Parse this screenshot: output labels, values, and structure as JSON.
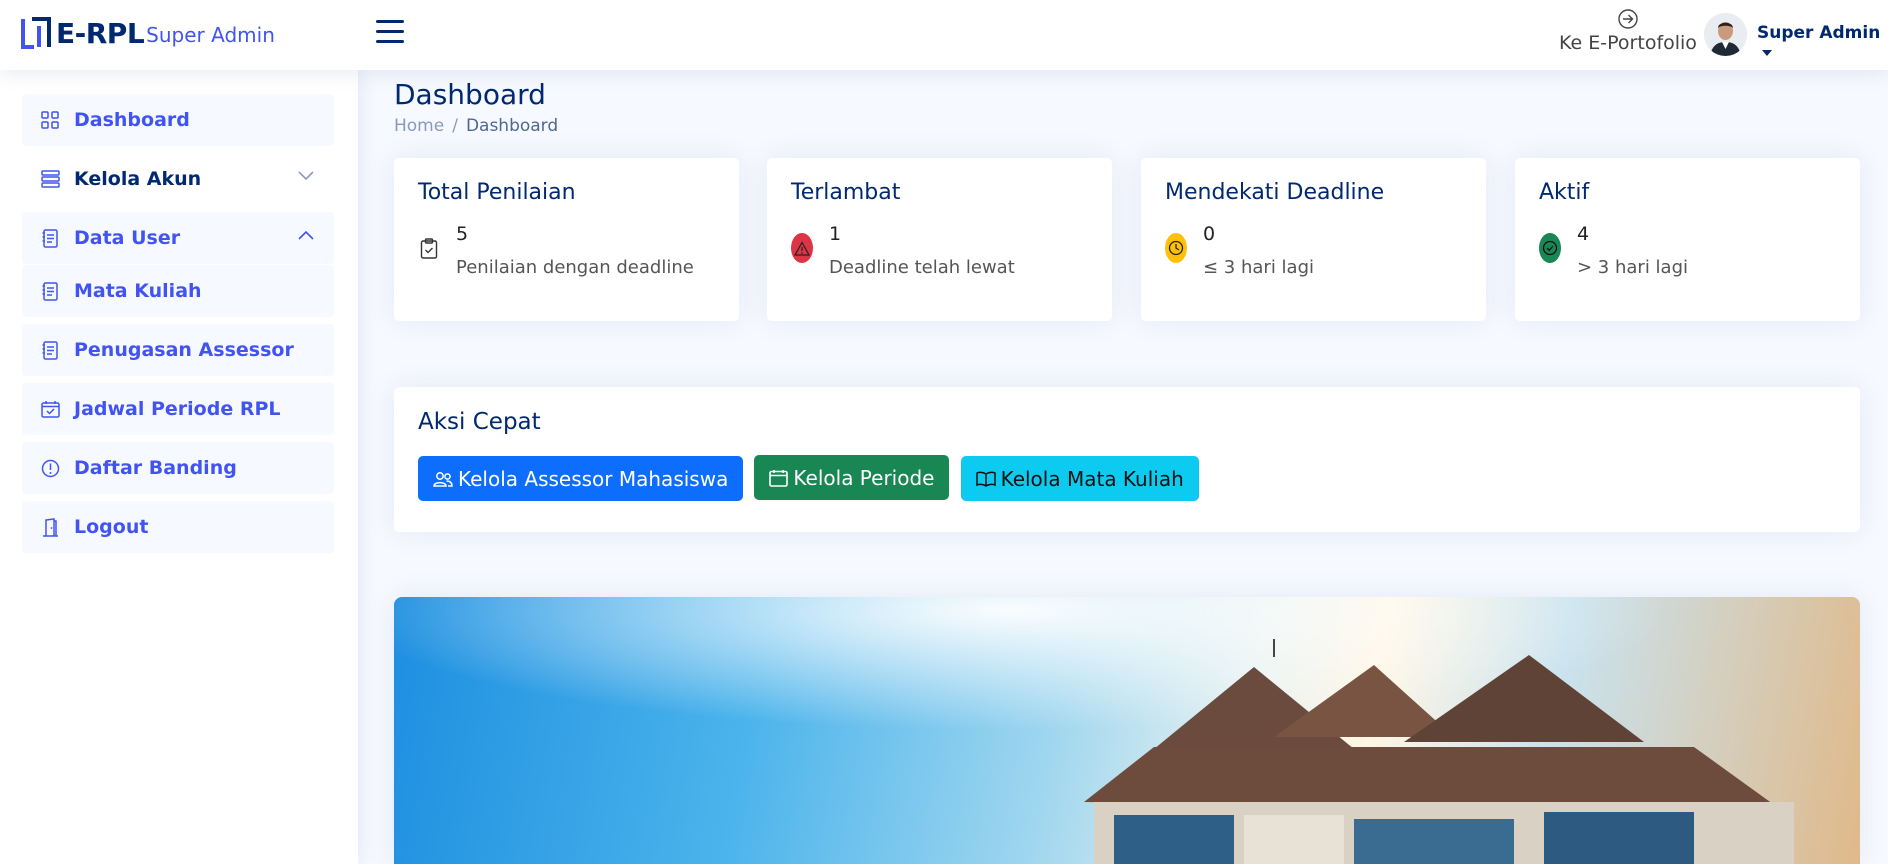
{
  "header": {
    "logo_text": "E-RPL",
    "logo_sub": "Super Admin",
    "portfolio_label": "Ke E-Portofolio",
    "user_name": "Super Admin"
  },
  "sidebar": {
    "items": [
      {
        "label": "Dashboard",
        "icon": "grid-icon"
      },
      {
        "label": "Kelola Akun",
        "icon": "server-icon",
        "chevron": "down"
      },
      {
        "label": "Data User",
        "icon": "document-icon",
        "chevron": "up"
      },
      {
        "label": "Mata Kuliah",
        "icon": "document-icon"
      },
      {
        "label": "Penugasan Assessor",
        "icon": "document-icon"
      },
      {
        "label": "Jadwal Periode RPL",
        "icon": "calendar-check-icon"
      },
      {
        "label": "Daftar Banding",
        "icon": "exclamation-circle-icon"
      },
      {
        "label": "Logout",
        "icon": "door-icon"
      }
    ]
  },
  "page": {
    "title": "Dashboard",
    "breadcrumb": [
      "Home",
      "Dashboard"
    ]
  },
  "stats": [
    {
      "title": "Total Penilaian",
      "value": "5",
      "desc": "Penilaian dengan deadline",
      "icon": "clipboard-check-icon",
      "color": "#ffffff"
    },
    {
      "title": "Terlambat",
      "value": "1",
      "desc": "Deadline telah lewat",
      "icon": "warning-triangle-icon",
      "color": "#dc3545"
    },
    {
      "title": "Mendekati Deadline",
      "value": "0",
      "desc": "≤ 3 hari lagi",
      "icon": "clock-icon",
      "color": "#ffc107"
    },
    {
      "title": "Aktif",
      "value": "4",
      "desc": "> 3 hari lagi",
      "icon": "check-circle-icon",
      "color": "#198754"
    }
  ],
  "quick": {
    "title": "Aksi Cepat",
    "buttons": [
      {
        "label": "Kelola Assessor Mahasiswa",
        "icon": "people-icon",
        "color": "#0d6efd"
      },
      {
        "label": "Kelola Periode",
        "icon": "calendar-icon",
        "color": "#198754"
      },
      {
        "label": "Kelola Mata Kuliah",
        "icon": "book-icon",
        "color": "#0dcaf0"
      }
    ]
  }
}
